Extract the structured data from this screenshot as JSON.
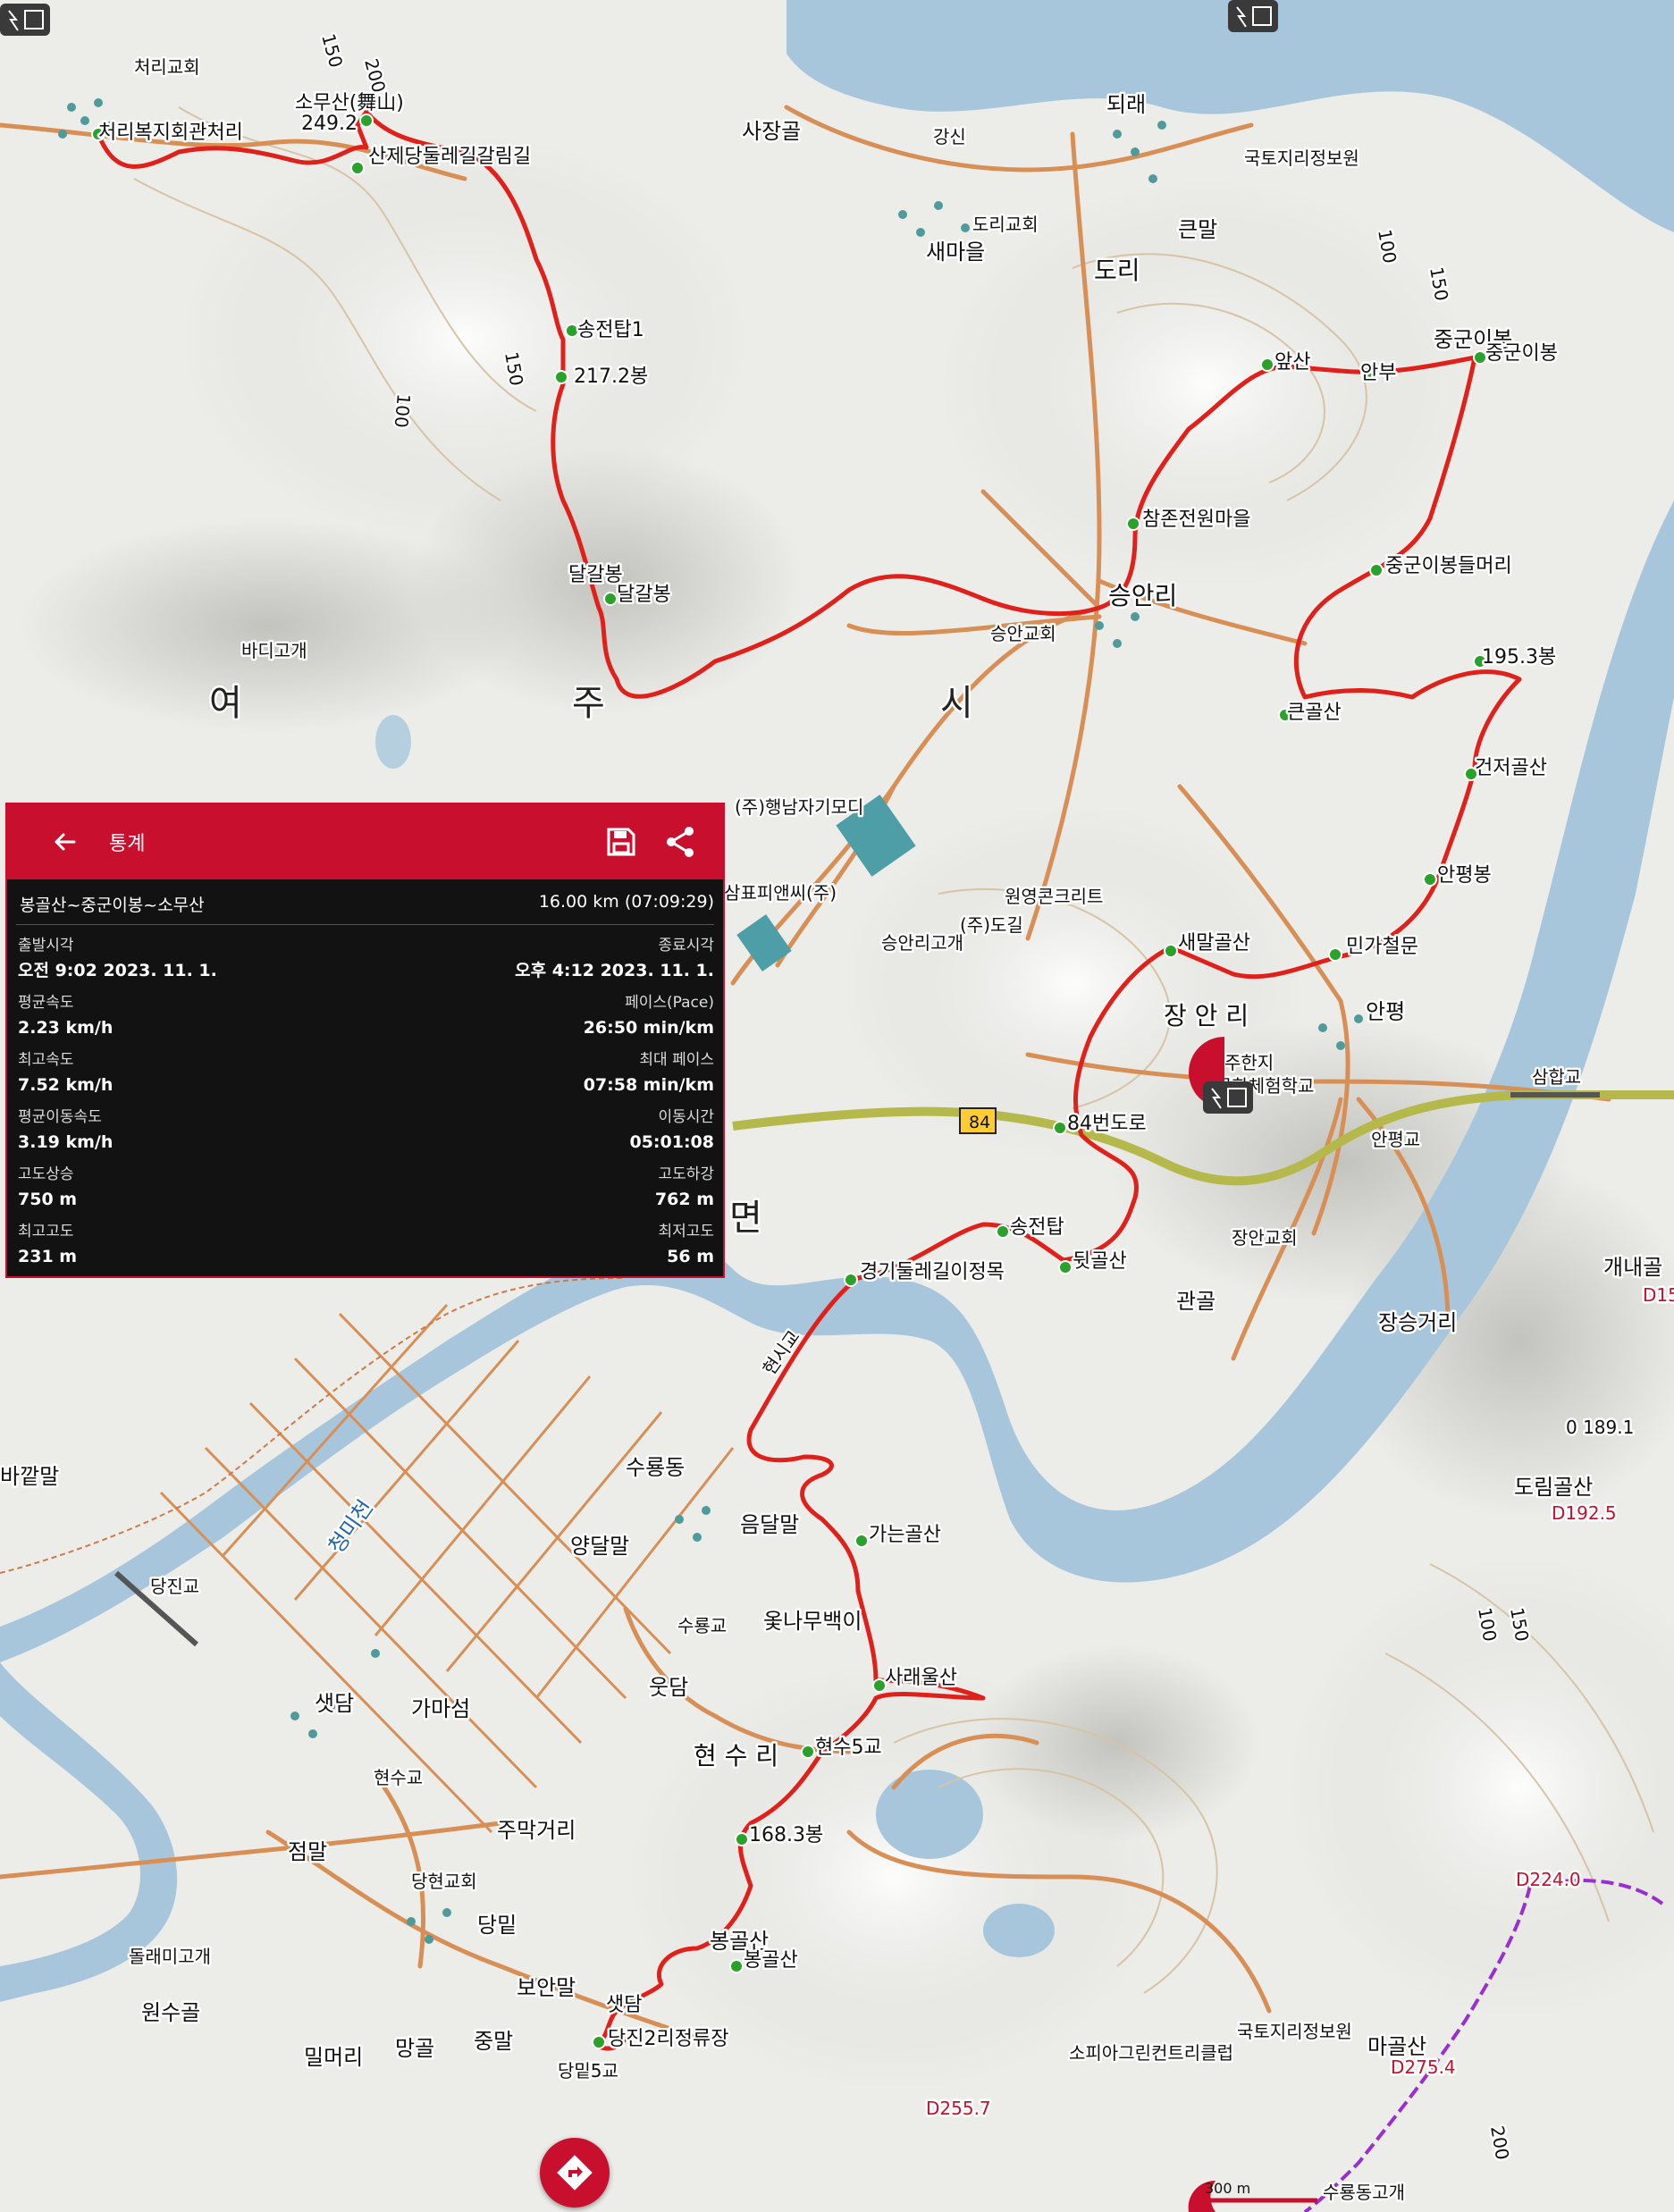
{
  "stats_panel": {
    "title": "통계",
    "route_name": "봉골산~중군이봉~소무산",
    "distance_duration": "16.00 km (07:09:29)",
    "rows": [
      {
        "left_key": "출발시각",
        "left_val": "오전 9:02 2023. 11. 1.",
        "right_key": "종료시각",
        "right_val": "오후 4:12 2023. 11. 1."
      },
      {
        "left_key": "평균속도",
        "left_val": "2.23 km/h",
        "right_key": "페이스(Pace)",
        "right_val": "26:50 min/km"
      },
      {
        "left_key": "최고속도",
        "left_val": "7.52 km/h",
        "right_key": "최대 페이스",
        "right_val": "07:58 min/km"
      },
      {
        "left_key": "평균이동속도",
        "left_val": "3.19 km/h",
        "right_key": "이동시간",
        "right_val": "05:01:08"
      },
      {
        "left_key": "고도상승",
        "left_val": "750 m",
        "right_key": "고도하강",
        "right_val": "762 m"
      },
      {
        "left_key": "최고고도",
        "left_val": "231 m",
        "right_key": "최저고도",
        "right_val": "56 m"
      }
    ]
  },
  "waypoints": {
    "somusan": "소무산(舞山)",
    "cheorivillage": "처리복지회관처리",
    "sanje": "산제당둘레길갈림길",
    "tower1": "송전탑1",
    "peak2172": "217.2봉",
    "dalgalbong": "달갈봉",
    "dalgalbong2": "달갈봉",
    "ansan": "앞산",
    "anbu": "안부",
    "junggunibong": "중군이봉",
    "junggunibong2": "중군이봉",
    "chamjon": "참존전원마을",
    "junggunmeori": "중군이봉들머리",
    "peak1953": "195.3봉",
    "keungolsan": "큰골산",
    "geonjeogolsan": "건저골산",
    "anpyeongbong": "안평봉",
    "saemalgolsan": "새말골산",
    "mingacheolmun": "민가철문",
    "road84": "84번도로",
    "tower2": "송전탑",
    "dwitgolsan": "뒷골산",
    "gyeonggi": "경기둘레길이정목",
    "ganeungolsan": "가는골산",
    "saraeulsan": "사래울산",
    "hyeonsu5": "현수5교",
    "peak1683": "168.3봉",
    "bonggolsan": "봉골산",
    "bonggolsan2": "봉골산",
    "dangjin": "당진2리정류장",
    "saetdam": "샛담"
  },
  "places": {
    "cheori_church": "처리교회",
    "sajanggol": "사장골",
    "gangsin": "강신",
    "doeri_church": "도리교회",
    "saemaeul": "새마을",
    "doeri": "도리",
    "keunmal": "큰말",
    "doerae": "되래",
    "ngii": "국토지리정보원",
    "ngii2": "국토지리정보원",
    "bodigogae": "바디고개",
    "yeo": "여",
    "ju": "주",
    "si": "시",
    "myeon": "면",
    "seungan_church": "승안교회",
    "seunganri": "승안리",
    "haengnam": "(주)행남자기모디",
    "sampyo": "삼표피앤씨(주)",
    "wonyeong": "원영콘크리트",
    "dogil": "(주)도길",
    "seungangogae": "승안리고개",
    "janganri": "장 안 리",
    "anpyeong": "안평",
    "juhanji": "주한지",
    "school": "문화체험학교",
    "samhapgyo": "삼합교",
    "anpyeonggyo": "안평교",
    "jangan_church": "장안교회",
    "gwangol": "관골",
    "jangseung": "장승거리",
    "gaenae": "개내골",
    "hyeonsigyo": "현시교",
    "cheongmicheon": "청미천",
    "dangjingyo": "당진교",
    "baggatmal": "바깥말",
    "surongdong": "수룡동",
    "eumdalmal": "음달말",
    "yangdalmal": "양달말",
    "otnamu": "옻나무백이",
    "suronggyo": "수룡교",
    "utdam": "웃담",
    "saetdam_v": "샛담",
    "gamaseom": "가마섬",
    "hyeonsugyo": "현수교",
    "hyeonsuri": "현 수 리",
    "jeommal": "점말",
    "jumakgeori": "주막거리",
    "danghyeon_church": "당현교회",
    "dangmit": "당밑",
    "dolraemi": "돌래미고개",
    "wonsugol": "원수골",
    "bomanmal": "보안말",
    "milmeori": "밀머리",
    "manggol": "망골",
    "jungmal": "중말",
    "dangmit5": "당밑5교",
    "sophia": "소피아그린컨트리클럽",
    "dorimgolsan": "도림골산",
    "magolsan": "마골산",
    "suryonggogae": "수룡동고개"
  },
  "elevations": {
    "e1891": "0 189.1",
    "e1925": "D192.5",
    "e2240": "D224.0",
    "e2754": "D275.4",
    "e2557": "D255.7",
    "e15": "D15",
    "e2492": "249.2"
  },
  "contours": {
    "c150a": "150",
    "c200": "200",
    "c100a": "100",
    "c150b": "150",
    "c100b": "100",
    "c150c": "150",
    "c100c": "100",
    "c150d": "150",
    "c200b": "200"
  },
  "road_number": "84",
  "scale_label": "300 m",
  "colors": {
    "track": "#e0211b",
    "panel_header": "#c8102e",
    "panel_bg": "#121212",
    "waypoint": "#2aa12a",
    "water": "#a7c6dc",
    "road": "#d88f56",
    "highway": "#b5b84a",
    "route_purple": "#9a2fd0"
  }
}
